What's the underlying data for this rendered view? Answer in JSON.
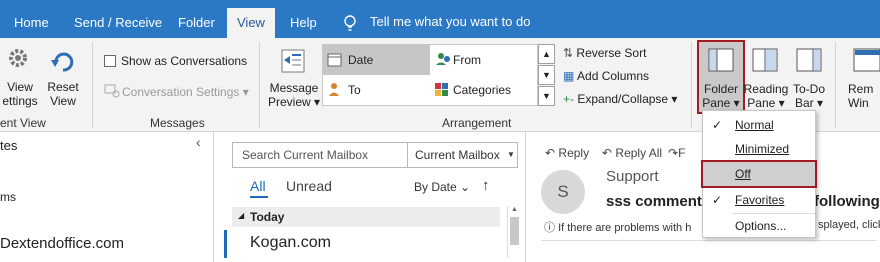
{
  "tabs": {
    "home": "Home",
    "send_receive": "Send / Receive",
    "folder": "Folder",
    "view": "View",
    "help": "Help",
    "tell_me": "Tell me what you want to do"
  },
  "ribbon": {
    "current_view": {
      "view_settings_line1": "View",
      "view_settings_line2": "ettings",
      "group_label": "ent View"
    },
    "reset_view_line1": "Reset",
    "reset_view_line2": "View",
    "messages": {
      "show_as_conversations": "Show as Conversations",
      "conversation_settings": "Conversation Settings",
      "group_label": "Messages"
    },
    "arrangement": {
      "message_preview_line1": "Message",
      "message_preview_line2": "Preview",
      "date": "Date",
      "from": "From",
      "to": "To",
      "categories": "Categories",
      "reverse_sort": "Reverse Sort",
      "add_columns": "Add Columns",
      "expand_collapse": "Expand/Collapse",
      "group_label": "Arrangement"
    },
    "layout": {
      "folder_pane_line1": "Folder",
      "folder_pane_line2": "Pane",
      "reading_pane_line1": "Reading",
      "reading_pane_line2": "Pane",
      "todo_bar_line1": "To-Do",
      "todo_bar_line2": "Bar",
      "reminders_line1": "Rem",
      "reminders_line2": "Win"
    }
  },
  "folder_pane": {
    "item1": "tes",
    "item2": "ms",
    "account": "Dextendoffice.com"
  },
  "mail_list": {
    "search_placeholder": "Search Current Mailbox",
    "scope": "Current Mailbox",
    "filter_all": "All",
    "filter_unread": "Unread",
    "sort_by": "By Date",
    "group_header": "Today",
    "first_sender": "Kogan.com"
  },
  "reading_pane": {
    "reply": "Reply",
    "reply_all": "Reply All",
    "forward_partial": "F",
    "avatar_initial": "S",
    "sender": "Support",
    "subject": "sss comment p",
    "subject_tail": "following",
    "info_bar": "If there are problems with h",
    "info_tail": "splayed, click"
  },
  "folder_pane_menu": {
    "normal": "Normal",
    "minimized": "Minimized",
    "off": "Off",
    "favorites": "Favorites",
    "options": "Options...",
    "checked": [
      "normal",
      "favorites"
    ]
  },
  "colors": {
    "tab_bar": "#2b78c5",
    "ribbon_bg": "#f3f3f3",
    "highlight_border": "#a21b24",
    "active_tab_text": "#2b579a",
    "accent_blue": "#1e6bb8"
  }
}
